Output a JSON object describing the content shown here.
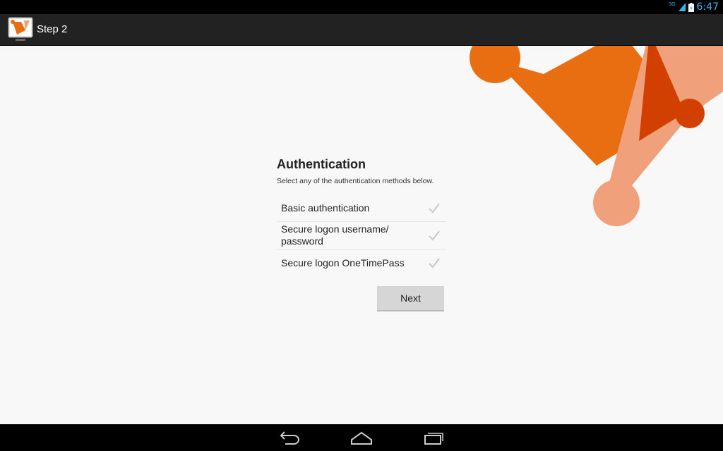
{
  "status_bar": {
    "time": "6:47",
    "network_label": "3G",
    "icons": [
      "signal-icon",
      "battery-icon"
    ],
    "accent_color": "#33b5e5"
  },
  "action_bar": {
    "title": "Step 2",
    "icon": "app-logo-icon"
  },
  "content": {
    "heading": "Authentication",
    "subtext": "Select any of the authentication methods below.",
    "methods": [
      {
        "label": "Basic authentication",
        "checked": false
      },
      {
        "label": "Secure logon username/ password",
        "checked": false
      },
      {
        "label": "Secure logon OneTimePass",
        "checked": false
      }
    ],
    "next_label": "Next"
  },
  "nav_bar": {
    "buttons": [
      "back-icon",
      "home-icon",
      "recent-apps-icon"
    ]
  },
  "colors": {
    "brand_orange": "#e96e12",
    "light_orange": "#f0a07a",
    "dark_orange": "#d24000"
  }
}
